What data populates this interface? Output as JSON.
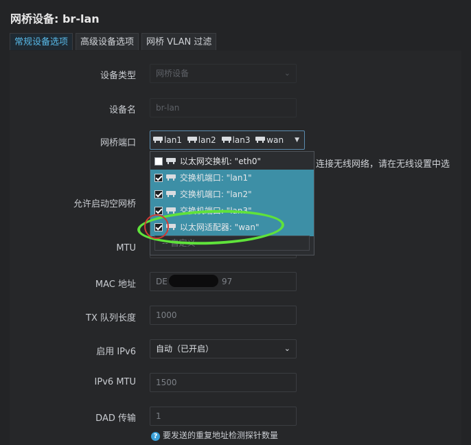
{
  "header": {
    "title": "网桥设备: br-lan"
  },
  "tabs": [
    {
      "label": "常规设备选项",
      "active": true
    },
    {
      "label": "高级设备选项",
      "active": false
    },
    {
      "label": "网桥 VLAN 过滤",
      "active": false
    }
  ],
  "form": {
    "device_type": {
      "label": "设备类型",
      "value": "网桥设备"
    },
    "device_name": {
      "label": "设备名",
      "value": "br-lan"
    },
    "bridge_ports": {
      "label": "网桥端口",
      "selected": [
        "lan1",
        "lan2",
        "lan3",
        "wan"
      ],
      "options": [
        {
          "label": "以太网交换机: \"eth0\"",
          "checked": false
        },
        {
          "label": "交换机端口: \"lan1\"",
          "checked": true
        },
        {
          "label": "交换机端口: \"lan2\"",
          "checked": true
        },
        {
          "label": "交换机端口: \"lan3\"",
          "checked": true
        },
        {
          "label": "以太网适配器: \"wan\"",
          "checked": true
        }
      ],
      "custom_placeholder": "-- 自定义 --",
      "hint": "连接无线网络，请在无线设置中选"
    },
    "bring_up_empty": {
      "label": "允许启动空网桥"
    },
    "mtu": {
      "label": "MTU"
    },
    "mac": {
      "label": "MAC 地址",
      "value_prefix": "DE",
      "value_suffix": "97"
    },
    "txqueuelen": {
      "label": "TX 队列长度",
      "placeholder": "1000"
    },
    "ipv6": {
      "label": "启用 IPv6",
      "value": "自动（已开启）"
    },
    "ipv6_mtu": {
      "label": "IPv6 MTU",
      "placeholder": "1500"
    },
    "dad": {
      "label": "DAD 传输",
      "placeholder": "1",
      "description": "要发送的重复地址检测探针数量"
    }
  },
  "colors": {
    "background": "#232426",
    "accent": "#58b9e8",
    "selected_option": "#3d8fa6",
    "annotation_green": "#5fe23b",
    "annotation_red": "#d23a34"
  }
}
